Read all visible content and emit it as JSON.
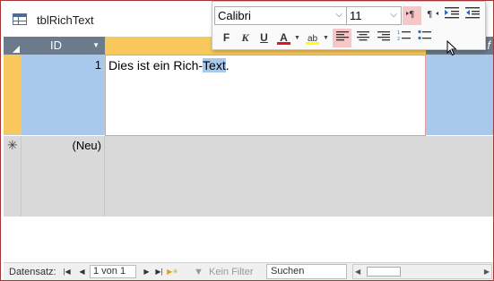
{
  "window": {
    "title": "tblRichText"
  },
  "grid": {
    "columns": [
      "ID",
      "",
      "f"
    ],
    "rows": [
      {
        "id": "1",
        "text_before": "Dies ist ein Rich-",
        "text_selected": "Text",
        "text_after": "."
      }
    ],
    "new_row": {
      "marker": "✳",
      "id_label": "(Neu)"
    }
  },
  "navigation": {
    "label": "Datensatz:",
    "record": "1 von 1",
    "filter": "Kein Filter",
    "search_placeholder": "Suchen"
  },
  "format_toolbar": {
    "font": "Calibri",
    "size": "11",
    "bold": "F",
    "italic": "K",
    "underline": "U",
    "font_color_letter": "A",
    "highlight_letters": "ab",
    "font_color": "#e81123",
    "highlight_color": "#ffff00",
    "active_color": "#f7c6c7",
    "active_buttons": [
      "ltr",
      "align-left"
    ]
  },
  "colors": {
    "header_gray": "#6b7b8c",
    "header_active": "#f9c85c",
    "selection_blue": "#a8c9ec",
    "new_row_gray": "#d9d9d9",
    "window_border": "#a4373a"
  }
}
